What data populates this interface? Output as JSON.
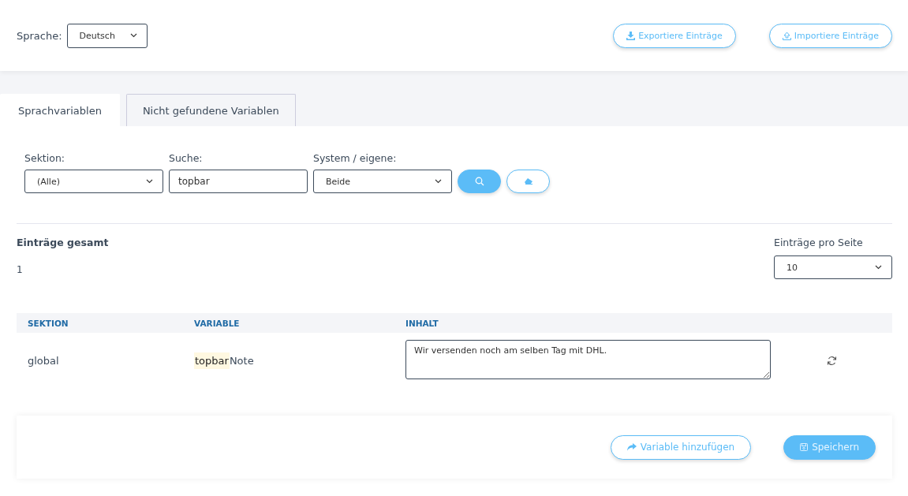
{
  "language": {
    "label": "Sprache:",
    "value": "Deutsch"
  },
  "header_buttons": [
    {
      "label": "Exportiere Einträge",
      "kind": "export"
    },
    {
      "label": "Importiere Einträge",
      "kind": "import"
    }
  ],
  "tabs": [
    {
      "label": "Sprachvariablen",
      "selected": true
    },
    {
      "label": "Nicht gefundene Variablen",
      "selected": false
    }
  ],
  "filters": {
    "section": {
      "label": "Sektion:",
      "value": "(Alle)"
    },
    "search": {
      "label": "Suche:",
      "value": "topbar"
    },
    "origin": {
      "label": "System / eigene:",
      "value": "Beide"
    }
  },
  "totals": {
    "label": "Einträge gesamt",
    "value": "1"
  },
  "per_page": {
    "label": "Einträge pro Seite",
    "value": "10"
  },
  "table": {
    "columns": [
      "SEKTION",
      "VARIABLE",
      "INHALT"
    ],
    "rows": [
      {
        "section": "global",
        "variable_match": "topbar",
        "variable_rest": "Note",
        "content": "Wir versenden noch am selben Tag mit DHL."
      }
    ]
  },
  "footer_buttons": [
    {
      "label": "Variable hinzufügen",
      "kind": "add"
    },
    {
      "label": "Speichern",
      "kind": "save"
    }
  ]
}
